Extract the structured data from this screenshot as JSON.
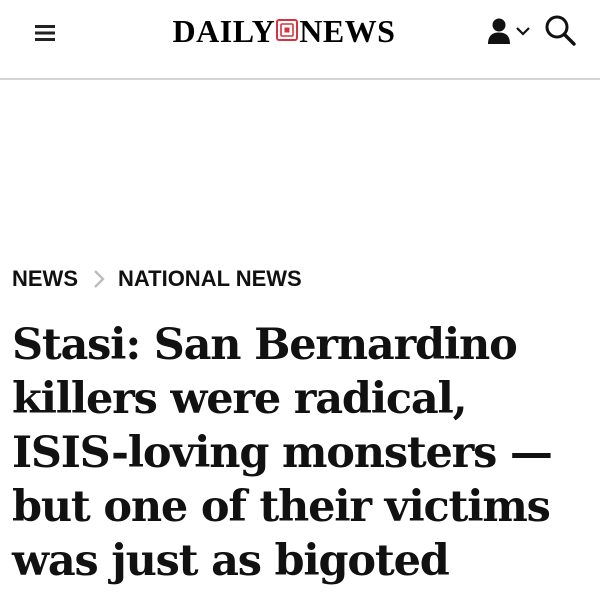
{
  "header": {
    "logo_left": "DAILY",
    "logo_right": "NEWS",
    "menu_icon": "hamburger-menu-icon",
    "account_icon": "user-icon",
    "dropdown_icon": "chevron-down-icon",
    "search_icon": "search-icon",
    "seal_color": "#d6333f"
  },
  "breadcrumb": {
    "items": [
      {
        "label": "NEWS"
      },
      {
        "label": "NATIONAL NEWS"
      }
    ],
    "separator_icon": "chevron-right-icon"
  },
  "article": {
    "headline": "Stasi: San Bernardino killers were radical, ISIS-loving monsters — but one of their victims was just as bigoted"
  }
}
